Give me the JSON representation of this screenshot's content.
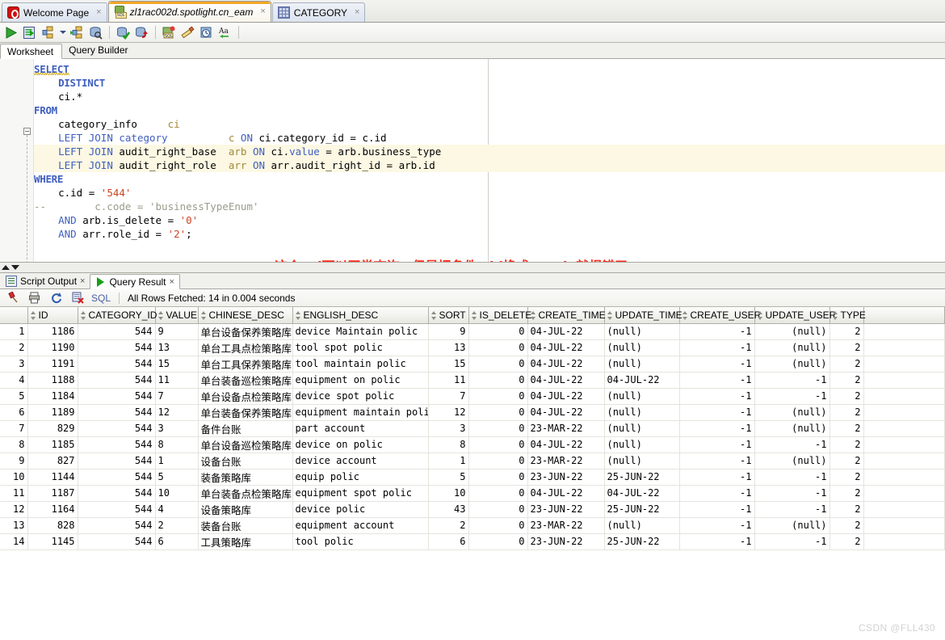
{
  "window": {
    "tabs": [
      {
        "label": "Welcome Page",
        "icon": "welcome-icon",
        "state": "inactive",
        "closable": true
      },
      {
        "label": "zl1rac002d.spotlight.cn_eam",
        "icon": "sql-connection-icon",
        "state": "active",
        "closable": true
      },
      {
        "label": "CATEGORY",
        "icon": "table-grid-icon",
        "state": "inactive",
        "closable": true
      }
    ],
    "close_glyph": "×"
  },
  "toolbar": {
    "buttons": [
      {
        "name": "run-statement-button",
        "title": "Run Statement"
      },
      {
        "name": "run-script-button",
        "title": "Run Script"
      },
      {
        "name": "explain-plan-button",
        "title": "Explain Plan"
      },
      {
        "name": "dropdown-caret",
        "title": "More"
      },
      {
        "name": "autotrace-button",
        "title": "Autotrace"
      },
      {
        "name": "sql-history-button",
        "title": "Query Builder"
      },
      {
        "name": "commit-button",
        "title": "Commit"
      },
      {
        "name": "rollback-button",
        "title": "Rollback"
      },
      {
        "name": "unshared-sql-worksheet-button",
        "title": "Unshared SQL Worksheet"
      },
      {
        "name": "clear-button",
        "title": "Clear"
      },
      {
        "name": "sql-history-panel-button",
        "title": "SQL History"
      },
      {
        "name": "format-case-button",
        "title": "Change Case"
      }
    ]
  },
  "worksheet_tabs": [
    {
      "label": "Worksheet",
      "selected": true
    },
    {
      "label": "Query Builder",
      "selected": false
    }
  ],
  "editor": {
    "annotation": "这个sql可以正常查询，但是把条件c.id换成c.code就报错了",
    "annotation_color": "#fd2a1a",
    "fold_glyph": "−",
    "lines": [
      "SELECT",
      "    DISTINCT",
      "    ci.*",
      "FROM",
      "    category_info     ci",
      "    LEFT JOIN category          c ON ci.category_id = c.id",
      "    LEFT JOIN audit_right_base  arb ON ci.value = arb.business_type",
      "    LEFT JOIN audit_right_role  arr ON arr.audit_right_id = arb.id",
      "WHERE",
      "    c.id = '544'",
      "--        c.code = 'businessTypeEnum'",
      "    AND arb.is_delete = '0'",
      "    AND arr.role_id = '2';"
    ]
  },
  "result_tabs": [
    {
      "label": "Script Output",
      "icon": "script-output-icon",
      "selected": false
    },
    {
      "label": "Query Result",
      "icon": "query-result-icon",
      "selected": true
    }
  ],
  "result_toolbar": {
    "sql_label": "SQL",
    "status": "All Rows Fetched: 14 in 0.004 seconds",
    "buttons": [
      {
        "name": "pin-button",
        "title": "Pin"
      },
      {
        "name": "print-button",
        "title": "Print"
      },
      {
        "name": "refresh-button",
        "title": "Refresh"
      },
      {
        "name": "clear-results-button",
        "title": "Clear"
      }
    ]
  },
  "grid": {
    "columns": [
      {
        "label": "ID",
        "width": 62,
        "align": "right"
      },
      {
        "label": "CATEGORY_ID",
        "width": 96,
        "align": "right"
      },
      {
        "label": "VALUE",
        "width": 53,
        "align": "left"
      },
      {
        "label": "CHINESE_DESC",
        "width": 117,
        "align": "left"
      },
      {
        "label": "ENGLISH_DESC",
        "width": 168,
        "align": "left"
      },
      {
        "label": "SORT",
        "width": 50,
        "align": "right"
      },
      {
        "label": "IS_DELETE",
        "width": 73,
        "align": "right"
      },
      {
        "label": "CREATE_TIME",
        "width": 95,
        "align": "left"
      },
      {
        "label": "UPDATE_TIME",
        "width": 93,
        "align": "left"
      },
      {
        "label": "CREATE_USER",
        "width": 93,
        "align": "right"
      },
      {
        "label": "UPDATE_USER",
        "width": 93,
        "align": "right"
      },
      {
        "label": "TYPE",
        "width": 42,
        "align": "right"
      }
    ],
    "rows": [
      {
        "n": "1",
        "ID": "1186",
        "CATEGORY_ID": "544",
        "VALUE": "9",
        "CHINESE_DESC": "单台设备保养策略库",
        "ENGLISH_DESC": "device Maintain polic",
        "SORT": "9",
        "IS_DELETE": "0",
        "CREATE_TIME": "04-JUL-22",
        "UPDATE_TIME": "(null)",
        "CREATE_USER": "-1",
        "UPDATE_USER": "(null)",
        "TYPE": "2"
      },
      {
        "n": "2",
        "ID": "1190",
        "CATEGORY_ID": "544",
        "VALUE": "13",
        "CHINESE_DESC": "单台工具点检策略库",
        "ENGLISH_DESC": "tool spot polic",
        "SORT": "13",
        "IS_DELETE": "0",
        "CREATE_TIME": "04-JUL-22",
        "UPDATE_TIME": "(null)",
        "CREATE_USER": "-1",
        "UPDATE_USER": "(null)",
        "TYPE": "2"
      },
      {
        "n": "3",
        "ID": "1191",
        "CATEGORY_ID": "544",
        "VALUE": "15",
        "CHINESE_DESC": "单台工具保养策略库",
        "ENGLISH_DESC": "tool maintain polic",
        "SORT": "15",
        "IS_DELETE": "0",
        "CREATE_TIME": "04-JUL-22",
        "UPDATE_TIME": "(null)",
        "CREATE_USER": "-1",
        "UPDATE_USER": "(null)",
        "TYPE": "2"
      },
      {
        "n": "4",
        "ID": "1188",
        "CATEGORY_ID": "544",
        "VALUE": "11",
        "CHINESE_DESC": "单台装备巡检策略库",
        "ENGLISH_DESC": "equipment on polic",
        "SORT": "11",
        "IS_DELETE": "0",
        "CREATE_TIME": "04-JUL-22",
        "UPDATE_TIME": "04-JUL-22",
        "CREATE_USER": "-1",
        "UPDATE_USER": "-1",
        "TYPE": "2"
      },
      {
        "n": "5",
        "ID": "1184",
        "CATEGORY_ID": "544",
        "VALUE": "7",
        "CHINESE_DESC": "单台设备点检策略库",
        "ENGLISH_DESC": "device spot polic",
        "SORT": "7",
        "IS_DELETE": "0",
        "CREATE_TIME": "04-JUL-22",
        "UPDATE_TIME": "(null)",
        "CREATE_USER": "-1",
        "UPDATE_USER": "-1",
        "TYPE": "2"
      },
      {
        "n": "6",
        "ID": "1189",
        "CATEGORY_ID": "544",
        "VALUE": "12",
        "CHINESE_DESC": "单台装备保养策略库",
        "ENGLISH_DESC": "equipment maintain polic",
        "SORT": "12",
        "IS_DELETE": "0",
        "CREATE_TIME": "04-JUL-22",
        "UPDATE_TIME": "(null)",
        "CREATE_USER": "-1",
        "UPDATE_USER": "(null)",
        "TYPE": "2"
      },
      {
        "n": "7",
        "ID": "829",
        "CATEGORY_ID": "544",
        "VALUE": "3",
        "CHINESE_DESC": "备件台账",
        "ENGLISH_DESC": "part account",
        "SORT": "3",
        "IS_DELETE": "0",
        "CREATE_TIME": "23-MAR-22",
        "UPDATE_TIME": "(null)",
        "CREATE_USER": "-1",
        "UPDATE_USER": "(null)",
        "TYPE": "2"
      },
      {
        "n": "8",
        "ID": "1185",
        "CATEGORY_ID": "544",
        "VALUE": "8",
        "CHINESE_DESC": "单台设备巡检策略库",
        "ENGLISH_DESC": "device on polic",
        "SORT": "8",
        "IS_DELETE": "0",
        "CREATE_TIME": "04-JUL-22",
        "UPDATE_TIME": "(null)",
        "CREATE_USER": "-1",
        "UPDATE_USER": "-1",
        "TYPE": "2"
      },
      {
        "n": "9",
        "ID": "827",
        "CATEGORY_ID": "544",
        "VALUE": "1",
        "CHINESE_DESC": "设备台账",
        "ENGLISH_DESC": "device account",
        "SORT": "1",
        "IS_DELETE": "0",
        "CREATE_TIME": "23-MAR-22",
        "UPDATE_TIME": "(null)",
        "CREATE_USER": "-1",
        "UPDATE_USER": "(null)",
        "TYPE": "2"
      },
      {
        "n": "10",
        "ID": "1144",
        "CATEGORY_ID": "544",
        "VALUE": "5",
        "CHINESE_DESC": "装备策略库",
        "ENGLISH_DESC": "equip polic",
        "SORT": "5",
        "IS_DELETE": "0",
        "CREATE_TIME": "23-JUN-22",
        "UPDATE_TIME": "25-JUN-22",
        "CREATE_USER": "-1",
        "UPDATE_USER": "-1",
        "TYPE": "2"
      },
      {
        "n": "11",
        "ID": "1187",
        "CATEGORY_ID": "544",
        "VALUE": "10",
        "CHINESE_DESC": "单台装备点检策略库",
        "ENGLISH_DESC": "equipment spot polic",
        "SORT": "10",
        "IS_DELETE": "0",
        "CREATE_TIME": "04-JUL-22",
        "UPDATE_TIME": "04-JUL-22",
        "CREATE_USER": "-1",
        "UPDATE_USER": "-1",
        "TYPE": "2"
      },
      {
        "n": "12",
        "ID": "1164",
        "CATEGORY_ID": "544",
        "VALUE": "4",
        "CHINESE_DESC": "设备策略库",
        "ENGLISH_DESC": "device polic",
        "SORT": "43",
        "IS_DELETE": "0",
        "CREATE_TIME": "23-JUN-22",
        "UPDATE_TIME": "25-JUN-22",
        "CREATE_USER": "-1",
        "UPDATE_USER": "-1",
        "TYPE": "2"
      },
      {
        "n": "13",
        "ID": "828",
        "CATEGORY_ID": "544",
        "VALUE": "2",
        "CHINESE_DESC": "装备台账",
        "ENGLISH_DESC": "equipment account",
        "SORT": "2",
        "IS_DELETE": "0",
        "CREATE_TIME": "23-MAR-22",
        "UPDATE_TIME": "(null)",
        "CREATE_USER": "-1",
        "UPDATE_USER": "(null)",
        "TYPE": "2"
      },
      {
        "n": "14",
        "ID": "1145",
        "CATEGORY_ID": "544",
        "VALUE": "6",
        "CHINESE_DESC": "工具策略库",
        "ENGLISH_DESC": "tool polic",
        "SORT": "6",
        "IS_DELETE": "0",
        "CREATE_TIME": "23-JUN-22",
        "UPDATE_TIME": "25-JUN-22",
        "CREATE_USER": "-1",
        "UPDATE_USER": "-1",
        "TYPE": "2"
      }
    ]
  },
  "watermark": "CSDN @FLL430"
}
